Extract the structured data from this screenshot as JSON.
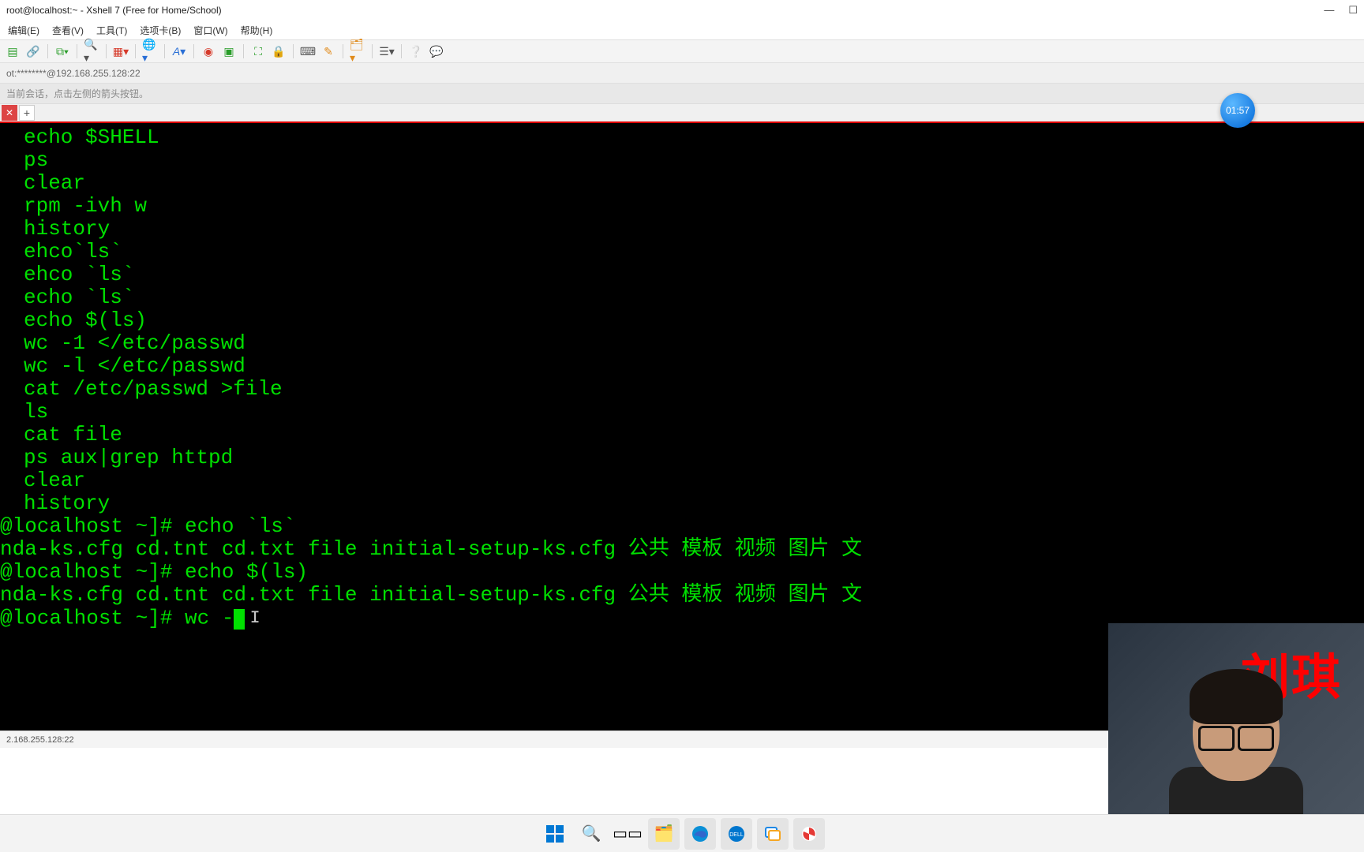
{
  "window": {
    "title": "root@localhost:~ - Xshell 7 (Free for Home/School)"
  },
  "menu": {
    "edit": "编辑(E)",
    "view": "查看(V)",
    "tools": "工具(T)",
    "tabs": "选项卡(B)",
    "window": "窗口(W)",
    "help": "帮助(H)"
  },
  "address": "ot:********@192.168.255.128:22",
  "hint": "当前会话，点击左侧的箭头按钮。",
  "timer": "01:57",
  "tab": {
    "add": "+"
  },
  "toolbar_icons": {
    "new": "new",
    "open": "open",
    "copy": "copy",
    "sep1": "",
    "search": "search",
    "sep2": "",
    "props": "props",
    "sep3": "",
    "globe": "globe",
    "sep4": "",
    "font": "font",
    "sep5": "",
    "stop": "stop",
    "rec": "rec",
    "sep6": "",
    "fullscr": "fullscr",
    "lock": "lock",
    "sep7": "",
    "kbd": "kbd",
    "brush": "brush",
    "sep8": "",
    "folder": "folder",
    "sep9": "",
    "list": "list",
    "sep10": "",
    "help": "help",
    "chat": "chat"
  },
  "history": [
    "echo $SHELL",
    "ps",
    "clear",
    "rpm -ivh w",
    "history",
    "ehco`ls`",
    "ehco `ls`",
    "echo `ls`",
    "echo $(ls)",
    "wc -1 </etc/passwd",
    "wc -l </etc/passwd",
    "cat /etc/passwd >file",
    "ls",
    "cat file",
    "ps aux|grep httpd",
    "clear",
    "history"
  ],
  "session": {
    "prompt1": "@localhost ~]# echo `ls`",
    "output1": "nda-ks.cfg cd.tnt cd.txt file initial-setup-ks.cfg 公共 模板 视频 图片 文",
    "prompt2": "@localhost ~]# echo $(ls)",
    "output2": "nda-ks.cfg cd.tnt cd.txt file initial-setup-ks.cfg 公共 模板 视频 图片 文",
    "prompt3a": "@localhost ~]# ",
    "prompt3b": "wc -"
  },
  "status": {
    "left": "2.168.255.128:22",
    "right_hint": "⌃"
  },
  "webcam": {
    "name_overlay": "刘琪"
  },
  "taskbar": {
    "start": "start",
    "search": "search",
    "taskview": "taskview",
    "explorer": "explorer",
    "edge": "edge",
    "dell": "dell",
    "vm": "vm",
    "xshell": "xshell"
  }
}
